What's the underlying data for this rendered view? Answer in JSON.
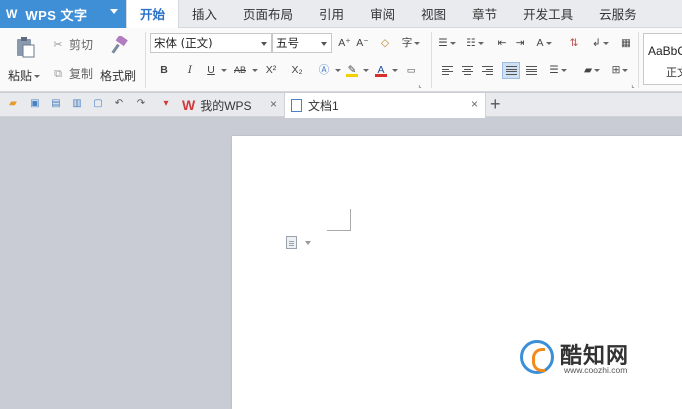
{
  "app": {
    "logo_letter": "W",
    "title": "WPS 文字"
  },
  "menus": [
    "开始",
    "插入",
    "页面布局",
    "引用",
    "审阅",
    "视图",
    "章节",
    "开发工具",
    "云服务"
  ],
  "ribbon": {
    "paste_label": "粘贴",
    "cut_label": "剪切",
    "copy_label": "复制",
    "format_painter_label": "格式刷",
    "font_name": "宋体 (正文)",
    "font_size": "五号",
    "grow_font": "A⁺",
    "shrink_font": "A⁻",
    "bold": "B",
    "italic": "I",
    "underline": "U",
    "strike": "AB",
    "superscript": "X²",
    "subscript": "X₂",
    "font_color_letter": "A",
    "style_sample": "AaBbC",
    "style_name": "正文"
  },
  "tabs": {
    "home": "我的WPS",
    "doc": "文档1",
    "close": "×",
    "new": "+"
  },
  "watermark": {
    "brand": "酷知网",
    "url": "www.coozhi.com"
  },
  "colors": {
    "accent": "#3f8fd6",
    "highlight": "#f5d000",
    "font_color": "#d9302c",
    "workspace": "#c9ccd4"
  }
}
